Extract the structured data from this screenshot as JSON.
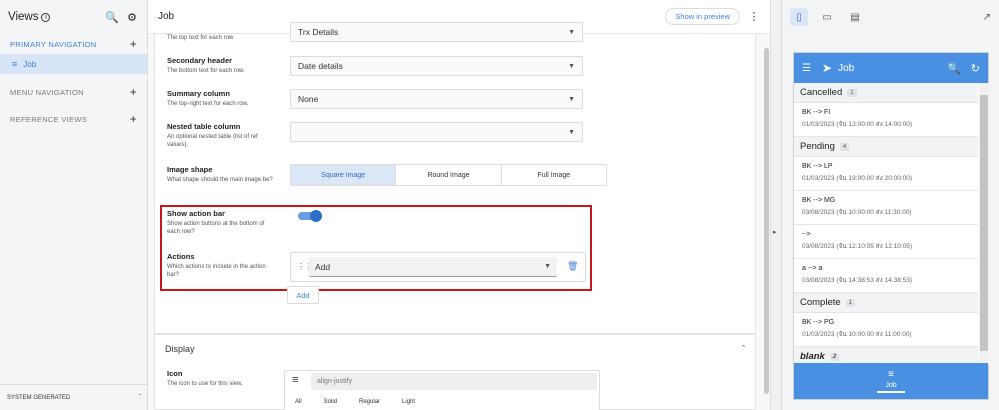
{
  "sidebar": {
    "title": "Views",
    "sections": [
      {
        "label": "PRIMARY NAVIGATION"
      },
      {
        "label": "MENU NAVIGATION"
      },
      {
        "label": "REFERENCE VIEWS"
      }
    ],
    "active_item": "Job",
    "footer": "SYSTEM GENERATED"
  },
  "main": {
    "title": "Job",
    "preview_button": "Show in preview",
    "primary_header_value": "Trx Details",
    "primary_header_desc": "The top text for each row",
    "secondary_header": {
      "label": "Secondary header",
      "desc": "The bottom text for each row.",
      "value": "Date details"
    },
    "summary_column": {
      "label": "Summary column",
      "desc": "The top-right text for each row.",
      "value": "None"
    },
    "nested_table": {
      "label": "Nested table column",
      "desc": "An optional nested table (list of ref values).",
      "value": ""
    },
    "image_shape": {
      "label": "Image shape",
      "desc": "What shape should the main image be?",
      "options": [
        "Square Image",
        "Round Image",
        "Full Image"
      ],
      "selected": "Square Image"
    },
    "show_action_bar": {
      "label": "Show action bar",
      "desc": "Show action buttons at the bottom of each row?",
      "on": true
    },
    "actions": {
      "label": "Actions",
      "desc": "Which actions to include in the action bar?",
      "value": "Add"
    },
    "add_button": "Add",
    "display": {
      "title": "Display",
      "icon_label": "Icon",
      "icon_desc": "The icon to use for this view.",
      "icon_value": "align-justify",
      "icon_tabs": [
        "All",
        "Solid",
        "Regular",
        "Light"
      ]
    }
  },
  "preview": {
    "app_title": "Job",
    "groups": [
      {
        "name": "Cancelled",
        "count": "1",
        "items": [
          {
            "title": "BK --> FI",
            "detail": "01/03/2023 (จัน 13:00:00 ส่ง 14:00:00)"
          }
        ]
      },
      {
        "name": "Pending",
        "count": "4",
        "items": [
          {
            "title": "BK --> LP",
            "detail": "01/03/2023 (จัน 19:00:00 ส่ง 20:00:00)"
          },
          {
            "title": "BK --> MG",
            "detail": "03/08/2023 (จัน 10:00:00 ส่ง 11:30:00)"
          },
          {
            "title": "-->",
            "detail": "03/08/2023 (จัน 12:10:05 ส่ง 12:10:05)"
          },
          {
            "title": "a --> a",
            "detail": "03/08/2023 (จัน 14:38:53 ส่ง 14:38:53)"
          }
        ]
      },
      {
        "name": "Complete",
        "count": "1",
        "items": [
          {
            "title": "BK --> PG",
            "detail": "01/03/2023 (จัน 10:00:00 ส่ง 11:00:00)"
          }
        ]
      },
      {
        "name": "blank",
        "count": "2",
        "items": []
      }
    ],
    "nav_label": "Job"
  },
  "colors": {
    "accent": "#4a90e2",
    "highlight_border": "#c8161d",
    "toggle": "#2f6ec6"
  }
}
